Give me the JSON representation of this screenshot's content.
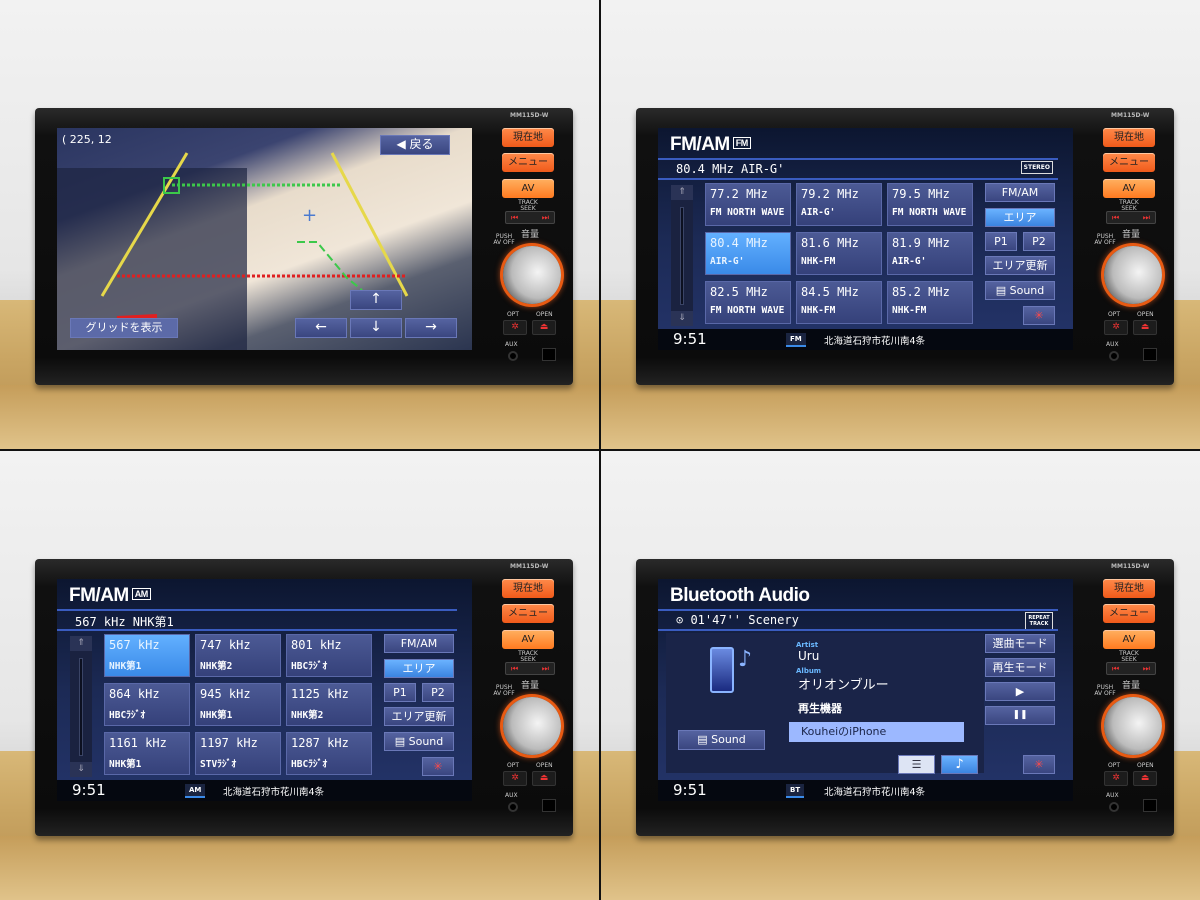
{
  "device": {
    "model": "MM115D-W",
    "buttons": {
      "current_location": "現在地",
      "menu": "メニュー",
      "av": "AV"
    },
    "labels": {
      "track_seek": "TRACK SEEK",
      "push_av_off": "PUSH AV OFF",
      "volume": "音量",
      "opt": "OPT",
      "open": "OPEN",
      "aux": "AUX"
    },
    "accent_color": "#f05a1a"
  },
  "camera_screen": {
    "coordinates": "( 225, 12",
    "back_button": "◀ 戻る",
    "show_grid_button": "グリッドを表示",
    "arrows": [
      "↑",
      "←",
      "↓",
      "→"
    ]
  },
  "fm_screen": {
    "title": "FM/AM",
    "band_badge": "FM",
    "current": "80.4 MHz AIR-G'",
    "stereo_badge": "STEREO",
    "presets": [
      {
        "freq": "77.2 MHz",
        "name": "FM NORTH WAVE"
      },
      {
        "freq": "79.2 MHz",
        "name": "AIR-G'"
      },
      {
        "freq": "79.5 MHz",
        "name": "FM NORTH WAVE"
      },
      {
        "freq": "80.4 MHz",
        "name": "AIR-G'",
        "selected": true
      },
      {
        "freq": "81.6 MHz",
        "name": "NHK-FM"
      },
      {
        "freq": "81.9 MHz",
        "name": "AIR-G'"
      },
      {
        "freq": "82.5 MHz",
        "name": "FM NORTH WAVE"
      },
      {
        "freq": "84.5 MHz",
        "name": "NHK-FM"
      },
      {
        "freq": "85.2 MHz",
        "name": "NHK-FM"
      }
    ],
    "side_buttons": {
      "fmam": "FM/AM",
      "area": "エリア",
      "p1": "P1",
      "p2": "P2",
      "area_update": "エリア更新",
      "sound": "Sound",
      "star": "✳"
    },
    "status": {
      "time": "9:51",
      "source": "FM",
      "address": "北海道石狩市花川南4条"
    }
  },
  "am_screen": {
    "title": "FM/AM",
    "band_badge": "AM",
    "current": "567 kHz NHK第1",
    "presets": [
      {
        "freq": "567 kHz",
        "name": "NHK第1",
        "selected": true
      },
      {
        "freq": "747 kHz",
        "name": "NHK第2"
      },
      {
        "freq": "801 kHz",
        "name": "HBCﾗｼﾞｵ"
      },
      {
        "freq": "864 kHz",
        "name": "HBCﾗｼﾞｵ"
      },
      {
        "freq": "945 kHz",
        "name": "NHK第1"
      },
      {
        "freq": "1125 kHz",
        "name": "NHK第2"
      },
      {
        "freq": "1161 kHz",
        "name": "NHK第1"
      },
      {
        "freq": "1197 kHz",
        "name": "STVﾗｼﾞｵ"
      },
      {
        "freq": "1287 kHz",
        "name": "HBCﾗｼﾞｵ"
      }
    ],
    "side_buttons": {
      "fmam": "FM/AM",
      "area": "エリア",
      "p1": "P1",
      "p2": "P2",
      "area_update": "エリア更新",
      "sound": "Sound",
      "star": "✳"
    },
    "status": {
      "time": "9:51",
      "source": "AM",
      "address": "北海道石狩市花川南4条"
    }
  },
  "bt_screen": {
    "title": "Bluetooth Audio",
    "track": "01'47'' Scenery",
    "repeat_badge": "REPEAT TRACK",
    "artist_label": "Artist",
    "artist": "Uru",
    "album_label": "Album",
    "album": "オリオンブルー",
    "device_label": "再生機器",
    "device_name": "KouheiのiPhone",
    "sound_button": "Sound",
    "side_buttons": {
      "select_mode": "選曲モード",
      "play_mode": "再生モード",
      "play": "▶",
      "pause": "❚❚",
      "star": "✳"
    },
    "status": {
      "time": "9:51",
      "source": "BT",
      "address": "北海道石狩市花川南4条"
    }
  }
}
